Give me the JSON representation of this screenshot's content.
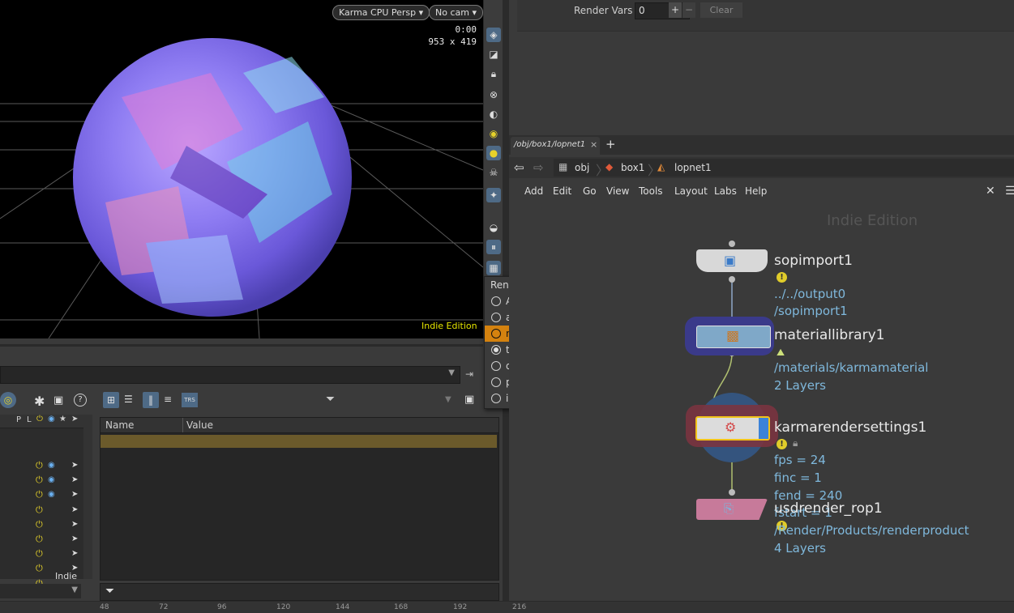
{
  "viewport": {
    "camera_dropdown": "Karma CPU Persp ▾",
    "cam_dropdown": "No cam ▾",
    "time": "0:00",
    "resolution": "953 x 419",
    "watermark": "Indie Edition"
  },
  "render_outputs_menu": {
    "title": "Render Outputs",
    "items": [
      {
        "label": "AO",
        "selected": false,
        "highlighted": false
      },
      {
        "label": "albedo",
        "selected": false,
        "highlighted": false
      },
      {
        "label": "roughness",
        "selected": false,
        "highlighted": true
      },
      {
        "label": "tangent",
        "selected": true,
        "highlighted": false
      },
      {
        "label": "depth",
        "selected": false,
        "highlighted": false
      },
      {
        "label": "primId",
        "selected": false,
        "highlighted": false
      },
      {
        "label": "instanceId",
        "selected": false,
        "highlighted": false
      }
    ]
  },
  "params": {
    "render_vars_label": "Render Vars",
    "render_vars_value": "0",
    "plus": "+",
    "minus": "−",
    "clear": "Clear"
  },
  "scene_graph": {
    "col_headers": [
      "P",
      "L"
    ],
    "indie_label": "Indie"
  },
  "param_table": {
    "headers": [
      "Name",
      "Value"
    ]
  },
  "network": {
    "tab_label": "/obj/box1/lopnet1",
    "tab_close": "×",
    "tab_add": "+",
    "path": [
      "obj",
      "box1",
      "lopnet1"
    ],
    "menu": [
      "Add",
      "Edit",
      "Go",
      "View",
      "Tools",
      "Layout",
      "Labs",
      "Help"
    ],
    "watermark": "Indie Edition",
    "nodes": [
      {
        "name": "sopimport1",
        "info": [
          "../../output0",
          "/sopimport1"
        ]
      },
      {
        "name": "materiallibrary1",
        "info": [
          "/materials/karmamaterial",
          "2 Layers"
        ]
      },
      {
        "name": "karmarendersettings1",
        "info": [
          "fps = 24",
          "finc = 1",
          "fend = 240",
          "fstart = 1"
        ]
      },
      {
        "name": "usdrender_rop1",
        "info": [
          "/Render/Products/renderproduct",
          "4 Layers"
        ]
      }
    ]
  },
  "ruler": {
    "ticks": [
      "48",
      "72",
      "96",
      "120",
      "144",
      "168",
      "192",
      "216"
    ]
  },
  "colors": {
    "highlight": "#d4820f",
    "node_info": "#7fb8dc",
    "indie_yellow": "#e6e600"
  }
}
